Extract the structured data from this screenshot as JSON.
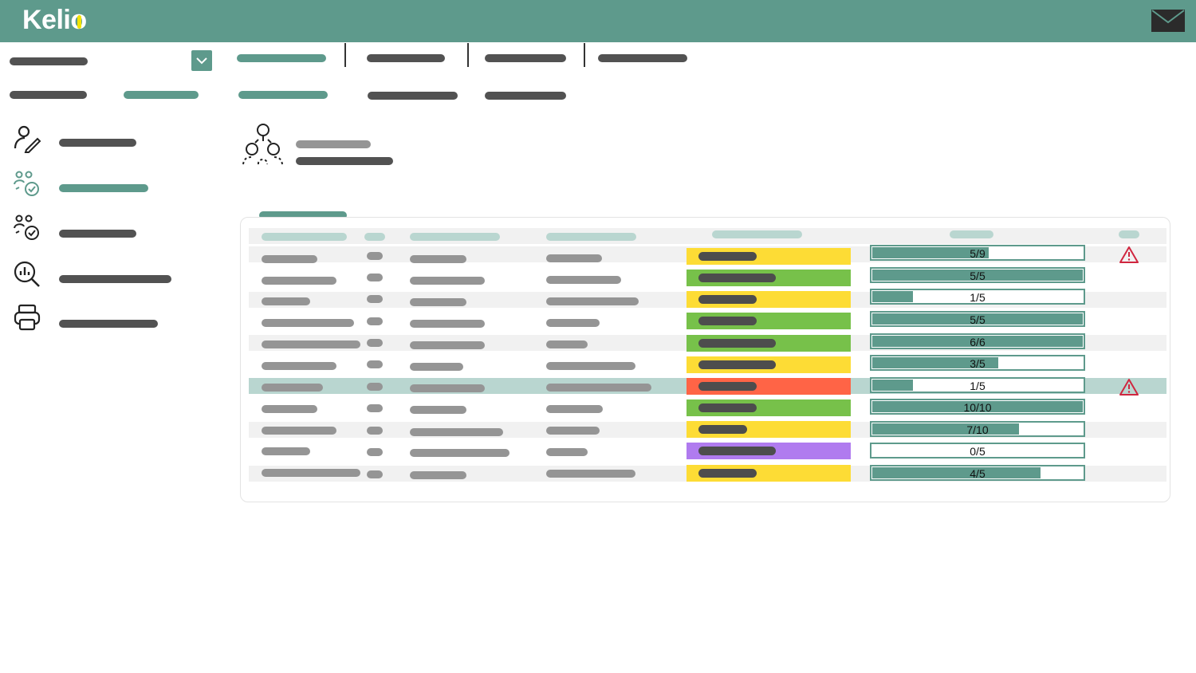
{
  "app": {
    "logo_text": "Kelio",
    "brand_color": "#5e9a8c",
    "accent_color": "#f3e300"
  },
  "header": {
    "mail_icon": "mail-icon"
  },
  "sidebar": {
    "items": [
      {
        "icon": "user-edit-icon",
        "active": false
      },
      {
        "icon": "team-check-icon",
        "active": true
      },
      {
        "icon": "team-check-icon",
        "active": false
      },
      {
        "icon": "search-analytics-icon",
        "active": false
      },
      {
        "icon": "printer-icon",
        "active": false
      }
    ]
  },
  "content": {
    "header_icon": "team-hierarchy-icon"
  },
  "status_colors": {
    "yellow": "#fddc35",
    "green": "#77c14a",
    "red": "#ff6446",
    "purple": "#b07bef"
  },
  "table": {
    "rows": [
      {
        "status": "yellow",
        "progress": "5/9",
        "ratio": 0.556,
        "warning": true,
        "selected": false
      },
      {
        "status": "green",
        "progress": "5/5",
        "ratio": 1.0,
        "warning": false,
        "selected": false
      },
      {
        "status": "yellow",
        "progress": "1/5",
        "ratio": 0.2,
        "warning": false,
        "selected": false
      },
      {
        "status": "green",
        "progress": "5/5",
        "ratio": 1.0,
        "warning": false,
        "selected": false
      },
      {
        "status": "green",
        "progress": "6/6",
        "ratio": 1.0,
        "warning": false,
        "selected": false
      },
      {
        "status": "yellow",
        "progress": "3/5",
        "ratio": 0.6,
        "warning": false,
        "selected": false
      },
      {
        "status": "red",
        "progress": "1/5",
        "ratio": 0.2,
        "warning": true,
        "selected": true
      },
      {
        "status": "green",
        "progress": "10/10",
        "ratio": 1.0,
        "warning": false,
        "selected": false
      },
      {
        "status": "yellow",
        "progress": "7/10",
        "ratio": 0.7,
        "warning": false,
        "selected": false
      },
      {
        "status": "purple",
        "progress": "0/5",
        "ratio": 0.0,
        "warning": false,
        "selected": false
      },
      {
        "status": "yellow",
        "progress": "4/5",
        "ratio": 0.8,
        "warning": false,
        "selected": false
      }
    ]
  }
}
